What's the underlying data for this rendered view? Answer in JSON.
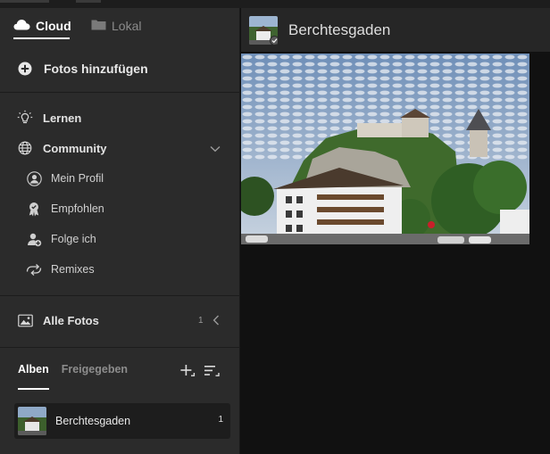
{
  "tabs": {
    "cloud": {
      "label": "Cloud",
      "icon": "cloud-icon",
      "active": true
    },
    "local": {
      "label": "Lokal",
      "icon": "folder-icon",
      "active": false
    }
  },
  "actions": {
    "add_photos": "Fotos hinzufügen"
  },
  "nav": {
    "learn": {
      "label": "Lernen",
      "icon": "lightbulb-icon"
    },
    "community": {
      "label": "Community",
      "icon": "globe-icon",
      "expanded": true,
      "items": [
        {
          "label": "Mein Profil",
          "icon": "user-profile-icon"
        },
        {
          "label": "Empfohlen",
          "icon": "award-ribbon-icon"
        },
        {
          "label": "Folge ich",
          "icon": "follow-user-icon"
        },
        {
          "label": "Remixes",
          "icon": "remix-icon"
        }
      ]
    },
    "all_photos": {
      "label": "Alle Fotos",
      "icon": "photo-library-icon",
      "count": "1"
    }
  },
  "albums": {
    "tabs": [
      {
        "label": "Alben",
        "active": true
      },
      {
        "label": "Freigegeben",
        "active": false
      }
    ],
    "items": [
      {
        "name": "Berchtesgaden",
        "count": "1"
      }
    ]
  },
  "main": {
    "title": "Berchtesgaden"
  },
  "colors": {
    "sidebar_bg": "#2b2b2b",
    "main_bg": "#111111",
    "header_bg": "#262626",
    "active_text": "#ffffff",
    "inactive_text": "#8b8b8b"
  }
}
